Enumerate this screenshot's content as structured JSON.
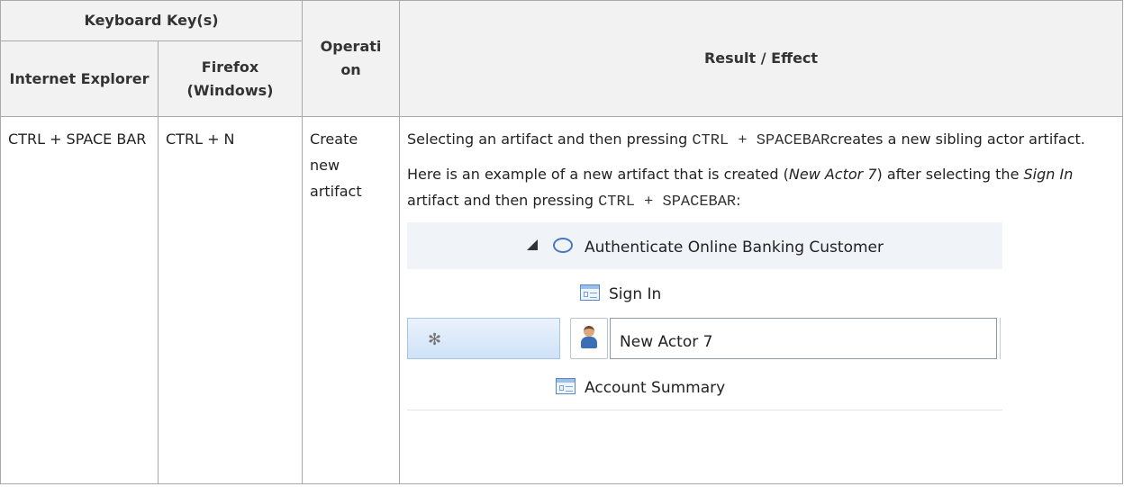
{
  "table": {
    "headers": {
      "keyboard_keys": "Keyboard Key(s)",
      "internet_explorer": "Internet Explorer",
      "firefox": "Firefox (Windows)",
      "operation": "Operati on",
      "result": "Result / Effect"
    },
    "row": {
      "ie_key": "CTRL + SPACE BAR",
      "firefox_key": "CTRL + N",
      "operation": "Create new artifact",
      "result": {
        "p1_before": "Selecting an artifact and then pressing ",
        "p1_code": "CTRL + SPACEBAR",
        "p1_after": "creates a new sibling actor artifact.",
        "p2_a": "Here is an example of a new artifact that is created (",
        "p2_em1": "New Actor 7",
        "p2_b": ") after selecting the ",
        "p2_em2": "Sign In",
        "p2_c": " artifact and then pressing ",
        "p2_code": "CTRL + SPACEBAR",
        "p2_end": ":"
      }
    }
  },
  "tree": {
    "items": [
      {
        "label": "Authenticate Online Banking Customer",
        "icon": "use-case-oval-icon"
      },
      {
        "label": "Sign In",
        "icon": "screen-icon"
      },
      {
        "label": "New Actor 7",
        "icon": "actor-icon",
        "marker": "✻"
      },
      {
        "label": "Account Summary",
        "icon": "screen-icon"
      }
    ],
    "colors": {
      "header_bg": "#f2f2f2",
      "selected_bg": "#cfe2f7",
      "border": "#a9a9a9"
    }
  }
}
